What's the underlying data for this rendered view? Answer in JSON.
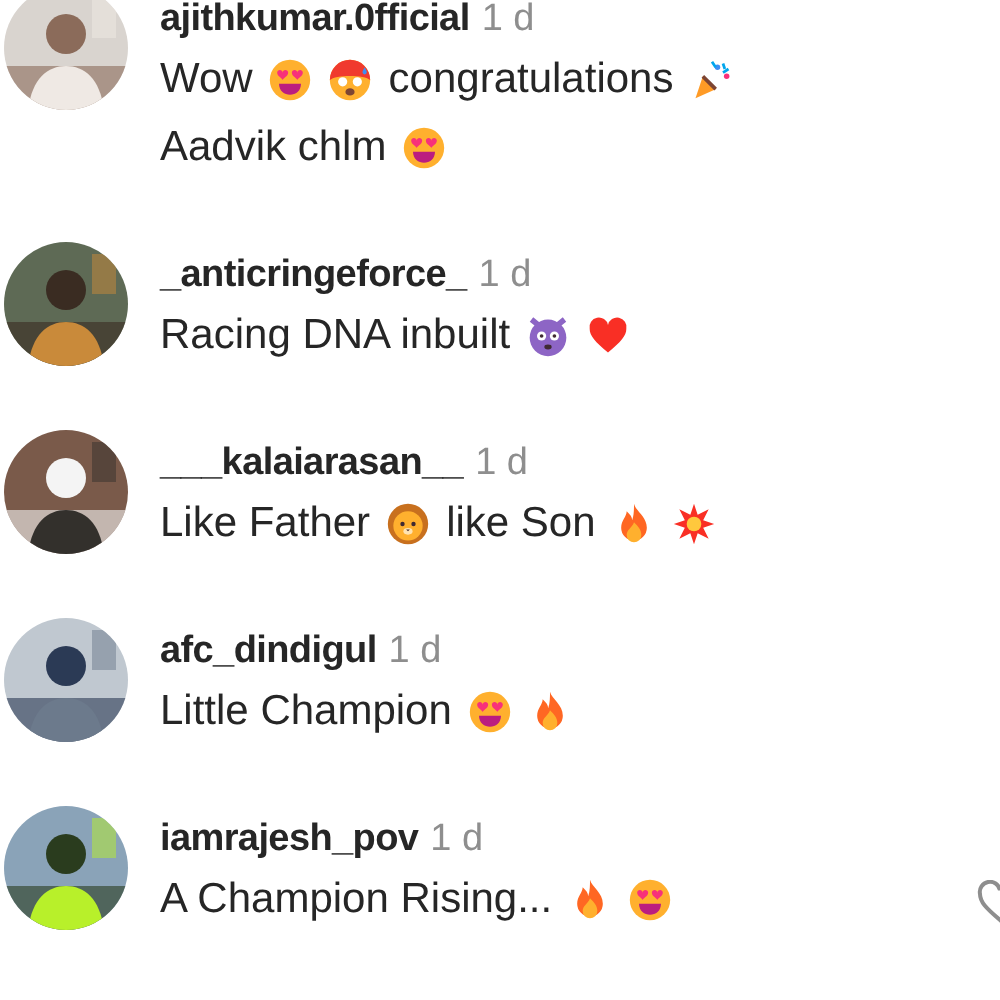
{
  "comments": [
    {
      "username": "ajithkumar.0fficial",
      "time": "1 d",
      "lines": [
        [
          {
            "kind": "text",
            "text": "Wow"
          },
          {
            "kind": "hearteyes"
          },
          {
            "kind": "hotface"
          },
          {
            "kind": "text",
            "text": "congratulations"
          },
          {
            "kind": "popper"
          }
        ],
        [
          {
            "kind": "text",
            "text": "Aadvik chlm"
          },
          {
            "kind": "hearteyes"
          }
        ]
      ]
    },
    {
      "username": "_anticringeforce_",
      "time": "1 d",
      "lines": [
        [
          {
            "kind": "text",
            "text": "Racing DNA inbuilt"
          },
          {
            "kind": "devil"
          },
          {
            "kind": "heart"
          }
        ]
      ]
    },
    {
      "username": "___kalaiarasan__",
      "time": "1 d",
      "lines": [
        [
          {
            "kind": "text",
            "text": "Like Father"
          },
          {
            "kind": "lion"
          },
          {
            "kind": "text",
            "text": "like Son"
          },
          {
            "kind": "fire"
          },
          {
            "kind": "collision"
          }
        ]
      ]
    },
    {
      "username": "afc_dindigul",
      "time": "1 d",
      "lines": [
        [
          {
            "kind": "text",
            "text": "Little Champion"
          },
          {
            "kind": "hearteyes"
          },
          {
            "kind": "fire"
          }
        ]
      ]
    },
    {
      "username": "iamrajesh_pov",
      "time": "1 d",
      "like_button": true,
      "lines": [
        [
          {
            "kind": "text",
            "text": "A Champion Rising..."
          },
          {
            "kind": "fire"
          },
          {
            "kind": "hearteyes"
          }
        ]
      ]
    }
  ]
}
